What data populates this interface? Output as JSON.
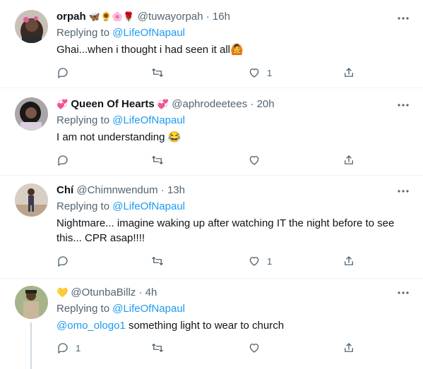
{
  "replies": [
    {
      "name": "orpah",
      "name_emoji": "🦋🌻🌸🌹",
      "handle": "@tuwayorpah",
      "dot": "·",
      "time": "16h",
      "replying_label": "Replying to",
      "replying_to": "@LifeOfNapaul",
      "text": "Ghai...when i thought i had seen it all",
      "text_emoji": "🙆",
      "reply_count": "",
      "retweet_count": "",
      "like_count": "1"
    },
    {
      "name_prefix_emoji": "💞",
      "name": "Queen Of Hearts",
      "name_emoji": "💞",
      "handle": "@aphrodeetees",
      "dot": "·",
      "time": "20h",
      "replying_label": "Replying to",
      "replying_to": "@LifeOfNapaul",
      "text": "I am not understanding",
      "text_emoji": "😂",
      "reply_count": "",
      "retweet_count": "",
      "like_count": ""
    },
    {
      "name": "Chí",
      "handle": "@Chimnwendum",
      "dot": "·",
      "time": "13h",
      "replying_label": "Replying to",
      "replying_to": "@LifeOfNapaul",
      "text_line1": "Nightmare... imagine waking up after watching IT the night before to see",
      "text_line2": "this... CPR asap!!!!",
      "reply_count": "",
      "retweet_count": "",
      "like_count": "1"
    },
    {
      "name_emoji": "💛",
      "handle": "@OtunbaBillz",
      "dot": "·",
      "time": "4h",
      "replying_label": "Replying to",
      "replying_to": "@LifeOfNapaul",
      "mention": "@omo_ologo1",
      "text": " something light to wear to church",
      "reply_count": "1",
      "retweet_count": "",
      "like_count": ""
    }
  ],
  "colors": {
    "accent": "#1d9bf0",
    "secondary_text": "#536471",
    "divider": "#eff3f4",
    "thread_line": "#cfd9de"
  }
}
